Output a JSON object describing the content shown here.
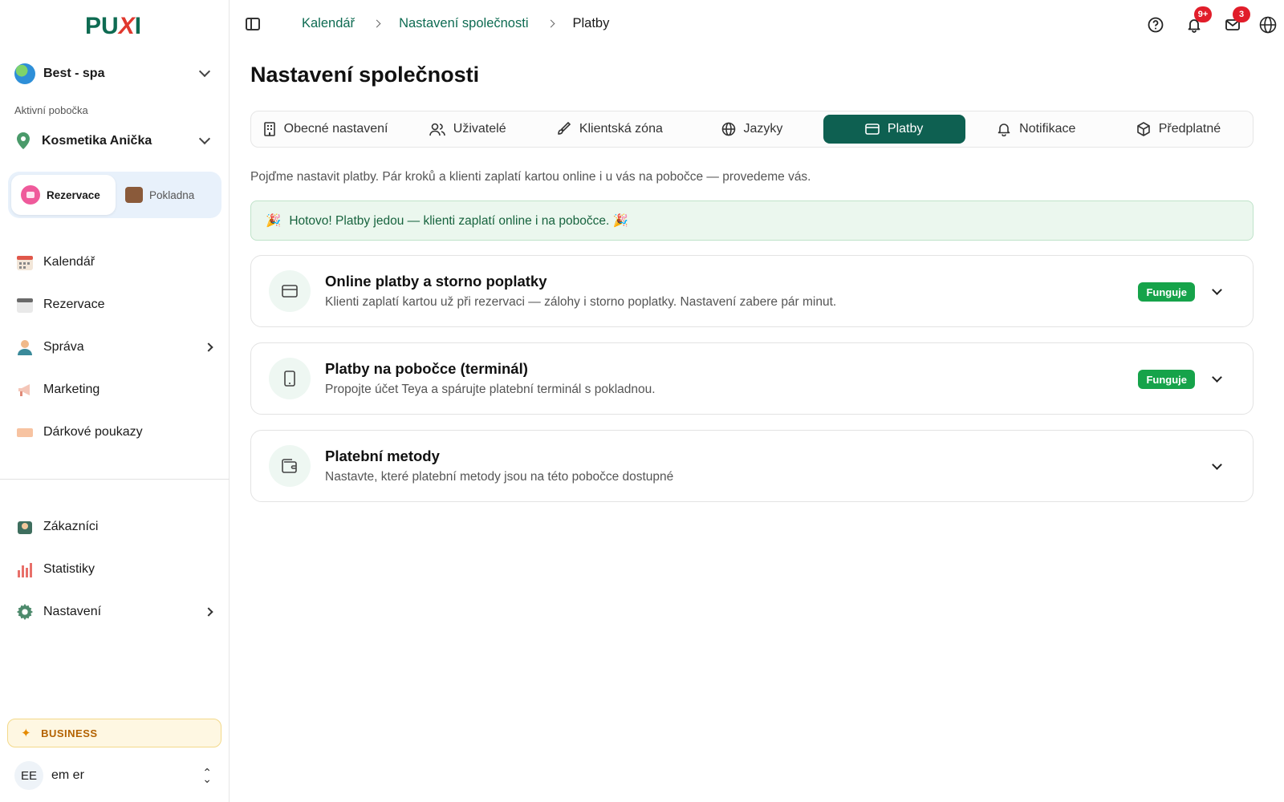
{
  "brand": {
    "logo_main": "PU",
    "logo_x": "X",
    "logo_end": "I"
  },
  "sidebar": {
    "org_name": "Best - spa",
    "branch_label": "Aktivní pobočka",
    "branch_name": "Kosmetika Anička",
    "modes": [
      {
        "label": "Rezervace",
        "active": true
      },
      {
        "label": "Pokladna",
        "active": false
      }
    ],
    "nav_primary": [
      {
        "label": "Kalendář",
        "icon": "calendar-icon",
        "has_children": false
      },
      {
        "label": "Rezervace",
        "icon": "reservation-icon",
        "has_children": false
      },
      {
        "label": "Správa",
        "icon": "person-icon",
        "has_children": true
      },
      {
        "label": "Marketing",
        "icon": "megaphone-icon",
        "has_children": false
      },
      {
        "label": "Dárkové poukazy",
        "icon": "voucher-icon",
        "has_children": false
      }
    ],
    "nav_secondary": [
      {
        "label": "Zákazníci",
        "icon": "customers-icon",
        "has_children": false
      },
      {
        "label": "Statistiky",
        "icon": "stats-icon",
        "has_children": false
      },
      {
        "label": "Nastavení",
        "icon": "gear-icon",
        "has_children": true
      }
    ],
    "plan_label": "BUSINESS",
    "user": {
      "initials": "EE",
      "name": "em er"
    }
  },
  "topbar": {
    "breadcrumbs": [
      "Kalendář",
      "Nastavení společnosti"
    ],
    "current": "Platby",
    "notifications_badge": "9+",
    "messages_badge": "3"
  },
  "main": {
    "title": "Nastavení společnosti",
    "tabs": [
      {
        "label": "Obecné nastavení",
        "icon": "building-icon",
        "active": false
      },
      {
        "label": "Uživatelé",
        "icon": "users-icon",
        "active": false
      },
      {
        "label": "Klientská zóna",
        "icon": "brush-icon",
        "active": false
      },
      {
        "label": "Jazyky",
        "icon": "globe-icon",
        "active": false
      },
      {
        "label": "Platby",
        "icon": "card-icon",
        "active": true
      },
      {
        "label": "Notifikace",
        "icon": "bell-icon",
        "active": false
      },
      {
        "label": "Předplatné",
        "icon": "package-icon",
        "active": false
      }
    ],
    "intro": "Pojďme nastavit platby. Pár kroků a klienti zaplatí kartou online i u vás na pobočce — provedeme vás.",
    "success_banner": "Hotovo! Platby jedou — klienti zaplatí online i na pobočce. 🎉",
    "cards": [
      {
        "title": "Online platby a storno poplatky",
        "desc": "Klienti zaplatí kartou už při rezervaci — zálohy i storno poplatky. Nastavení zabere pár minut.",
        "status": "Funguje",
        "icon": "credit-card-icon"
      },
      {
        "title": "Platby na pobočce (terminál)",
        "desc": "Propojte účet Teya a spárujte platební terminál s pokladnou.",
        "status": "Funguje",
        "icon": "tablet-icon"
      },
      {
        "title": "Platební metody",
        "desc": "Nastavte, které platební metody jsou na této pobočce dostupné",
        "status": "",
        "icon": "wallet-icon"
      }
    ]
  },
  "colors": {
    "brand": "#0e6b52",
    "active_tab": "#0e6051",
    "status_ok": "#16a34a",
    "badge": "#e11d2a"
  }
}
